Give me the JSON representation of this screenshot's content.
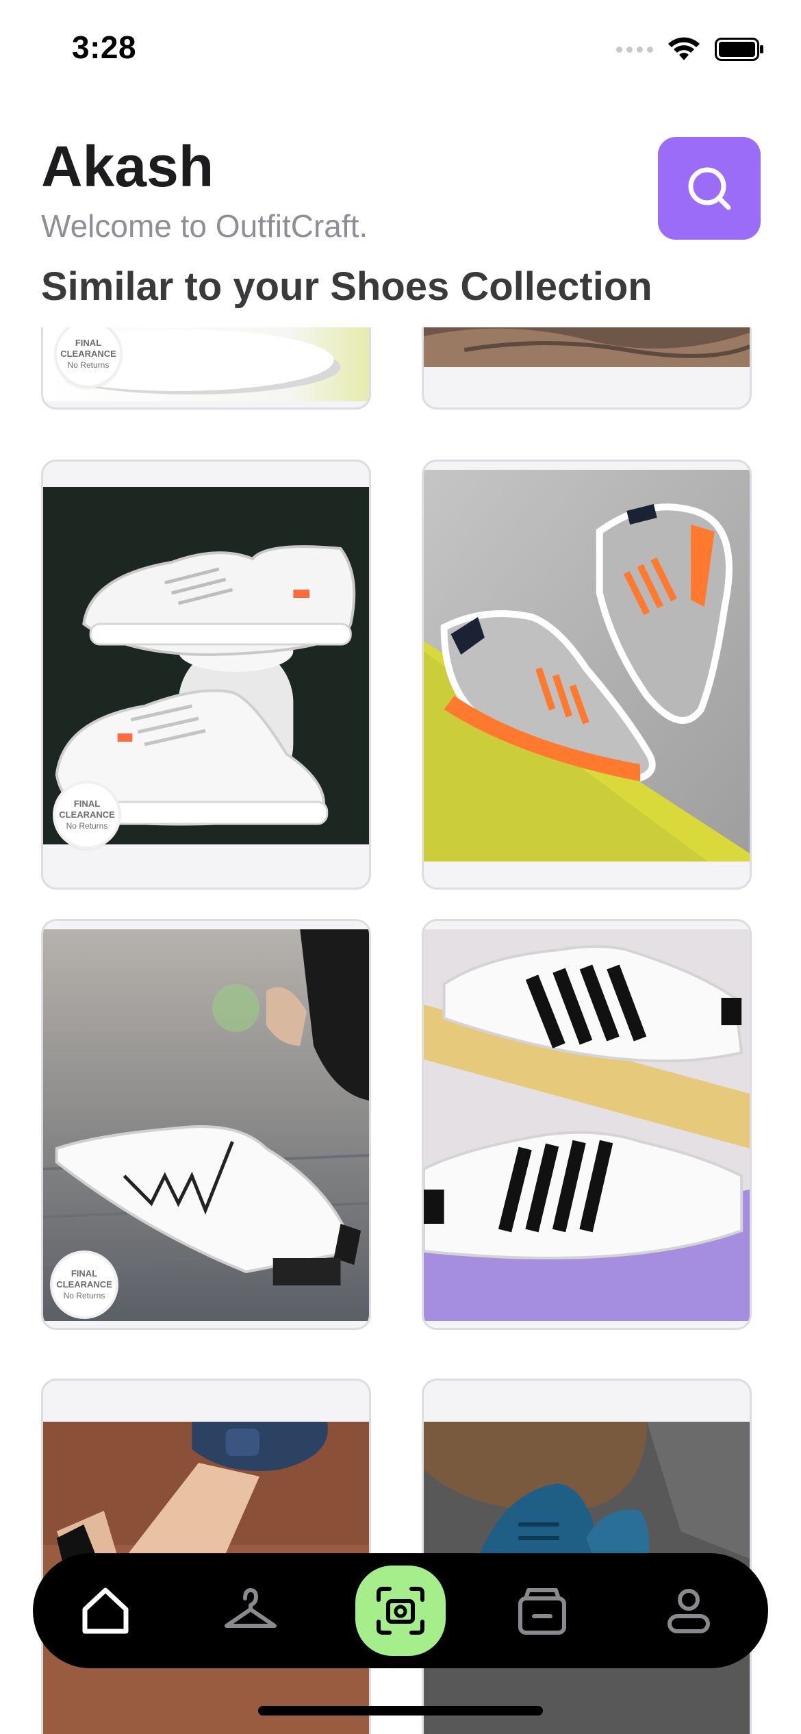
{
  "status_bar": {
    "time": "3:28"
  },
  "header": {
    "name": "Akash",
    "subtitle": "Welcome to OutfitCraft.",
    "section_title": "Similar to your Shoes Collection"
  },
  "badge": {
    "line1": "FINAL",
    "line2": "CLEARANCE",
    "line3": "No Returns"
  },
  "products": [
    {
      "name": "white-low-top-sneaker-partial",
      "badge": true
    },
    {
      "name": "shoe-on-rust-surface-partial",
      "badge": false
    },
    {
      "name": "white-leather-sneakers-pair",
      "badge": true
    },
    {
      "name": "grey-orange-running-shoes",
      "badge": false
    },
    {
      "name": "white-sneaker-zigzag-lacing",
      "badge": true
    },
    {
      "name": "white-black-striped-sneakers",
      "badge": false
    },
    {
      "name": "sneaker-with-denim-partial",
      "badge": false
    },
    {
      "name": "blue-knit-sneakers-partial",
      "badge": false
    }
  ],
  "nav": {
    "items": [
      "home",
      "wardrobe",
      "scan",
      "bag",
      "profile"
    ],
    "active": "home",
    "scan_color": "#a6ee8c"
  },
  "colors": {
    "accent": "#9a6cf7",
    "nav_bg": "#000000"
  }
}
